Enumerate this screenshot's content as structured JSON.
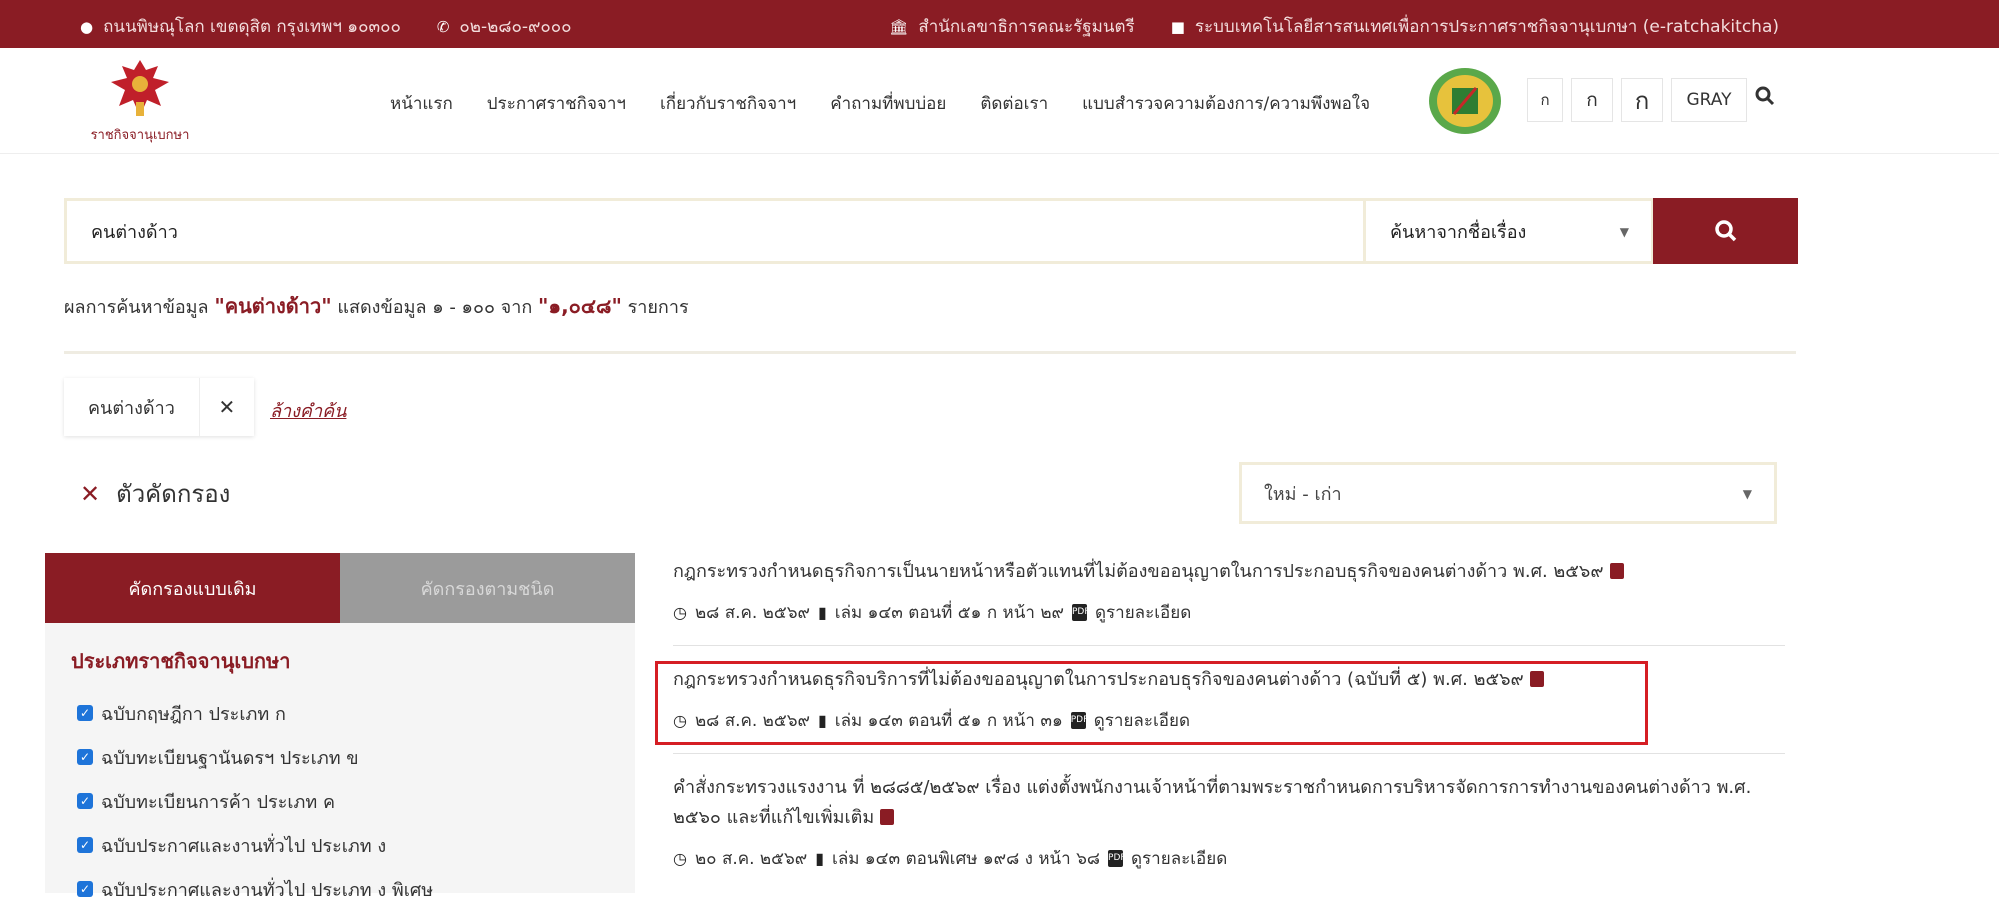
{
  "topbar": {
    "address": "ถนนพิษณุโลก เขตดุสิต กรุงเทพฯ ๑๐๓๐๐",
    "phone": "๐๒-๒๘๐-๙๐๐๐",
    "org": "สำนักเลขาธิการคณะรัฐมนตรี",
    "system": "ระบบเทคโนโลยีสารสนเทศเพื่อการประกาศราชกิจจานุเบกษา (e-ratchakitcha)"
  },
  "header": {
    "logo_text": "ราชกิจจานุเบกษา",
    "nav": [
      "หน้าแรก",
      "ประกาศราชกิจจาฯ",
      "เกี่ยวกับราชกิจจาฯ",
      "คำถามที่พบบ่อย",
      "ติดต่อเรา",
      "แบบสำรวจความต้องการ/ความพึงพอใจ"
    ],
    "font_buttons": [
      "ก",
      "ก",
      "ก",
      "GRAY"
    ]
  },
  "search": {
    "query": "คนต่างด้าว",
    "mode": "ค้นหาจากชื่อเรื่อง"
  },
  "result_info": {
    "prefix": "ผลการค้นหาข้อมูล",
    "term": "\"คนต่างด้าว\"",
    "middle": "แสดงข้อมูล ๑ - ๑๐๐ จาก",
    "total": "\"๑,๐๔๘\"",
    "suffix": "รายการ"
  },
  "chip": {
    "label": "คนต่างด้าว",
    "clear": "ล้างคำค้น"
  },
  "filter": {
    "title": "ตัวคัดกรอง"
  },
  "sort": {
    "selected": "ใหม่ - เก่า"
  },
  "sidebar": {
    "tabs": [
      "คัดกรองแบบเดิม",
      "คัดกรองตามชนิด"
    ],
    "title": "ประเภทราชกิจจานุเบกษา",
    "items": [
      "ฉบับกฤษฎีกา ประเภท ก",
      "ฉบับทะเบียนฐานันดรฯ ประเภท ข",
      "ฉบับทะเบียนการค้า ประเภท ค",
      "ฉบับประกาศและงานทั่วไป ประเภท ง",
      "ฉบับประกาศและงานทั่วไป ประเภท ง พิเศษ"
    ]
  },
  "results": [
    {
      "title": "กฎกระทรวงกำหนดธุรกิจการเป็นนายหน้าหรือตัวแทนที่ไม่ต้องขออนุญาตในการประกอบธุรกิจของคนต่างด้าว พ.ศ. ๒๕๖๙",
      "date": "๒๘ ส.ค. ๒๕๖๙",
      "volume": "เล่ม ๑๔๓ ตอนที่ ๕๑ ก หน้า ๒๙",
      "detail": "ดูรายละเอียด"
    },
    {
      "title": "กฎกระทรวงกำหนดธุรกิจบริการที่ไม่ต้องขออนุญาตในการประกอบธุรกิจของคนต่างด้าว (ฉบับที่ ๕) พ.ศ. ๒๕๖๙",
      "date": "๒๘ ส.ค. ๒๕๖๙",
      "volume": "เล่ม ๑๔๓ ตอนที่ ๕๑ ก หน้า ๓๑",
      "detail": "ดูรายละเอียด"
    },
    {
      "title": "คำสั่งกระทรวงแรงงาน ที่ ๒๘๘๕/๒๕๖๙ เรื่อง แต่งตั้งพนักงานเจ้าหน้าที่ตามพระราชกำหนดการบริหารจัดการการทำงานของคนต่างด้าว พ.ศ. ๒๕๖๐ และที่แก้ไขเพิ่มเติม",
      "date": "๒๐ ส.ค. ๒๕๖๙",
      "volume": "เล่ม ๑๔๓ ตอนพิเศษ ๑๙๘ ง หน้า ๖๘",
      "detail": "ดูรายละเอียด"
    }
  ],
  "colors": {
    "brand": "#8a1c24",
    "highlight": "#d51e24",
    "checkbox": "#1e74d9"
  }
}
